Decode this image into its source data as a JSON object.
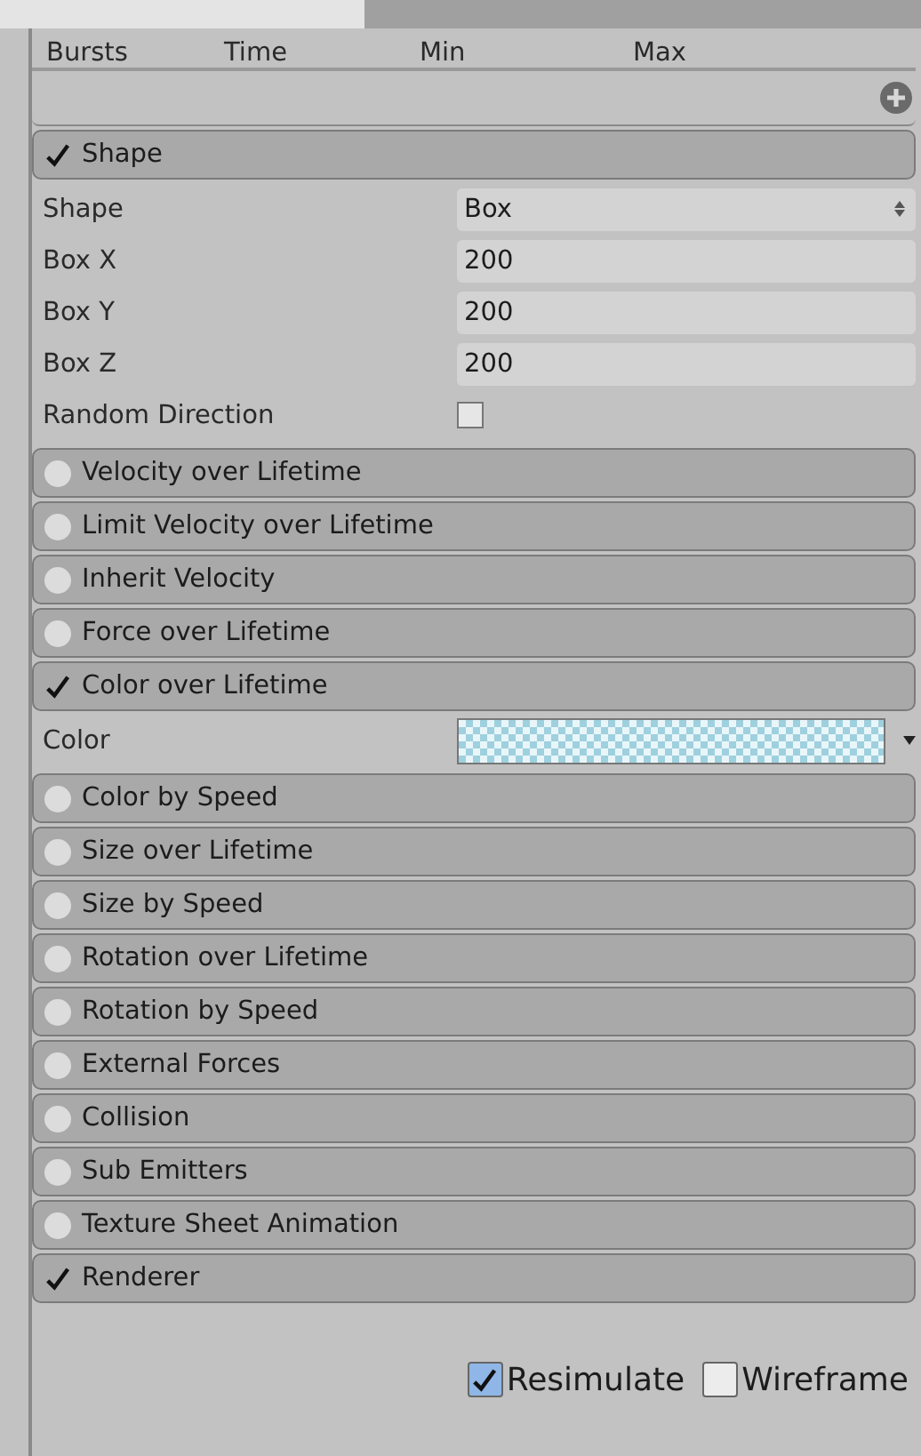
{
  "bursts": {
    "columns": [
      "Bursts",
      "Time",
      "Min",
      "Max"
    ]
  },
  "modules": [
    {
      "title": "Shape",
      "enabled": true,
      "fields": [
        {
          "kind": "dropdown",
          "label": "Shape",
          "value": "Box"
        },
        {
          "kind": "number",
          "label": "Box X",
          "value": "200"
        },
        {
          "kind": "number",
          "label": "Box Y",
          "value": "200"
        },
        {
          "kind": "number",
          "label": "Box Z",
          "value": "200"
        },
        {
          "kind": "checkbox",
          "label": "Random Direction",
          "checked": false
        }
      ]
    },
    {
      "title": "Velocity over Lifetime",
      "enabled": false
    },
    {
      "title": "Limit Velocity over Lifetime",
      "enabled": false
    },
    {
      "title": "Inherit Velocity",
      "enabled": false
    },
    {
      "title": "Force over Lifetime",
      "enabled": false
    },
    {
      "title": "Color over Lifetime",
      "enabled": true,
      "fields": [
        {
          "kind": "gradient",
          "label": "Color"
        }
      ]
    },
    {
      "title": "Color by Speed",
      "enabled": false
    },
    {
      "title": "Size over Lifetime",
      "enabled": false
    },
    {
      "title": "Size by Speed",
      "enabled": false
    },
    {
      "title": "Rotation over Lifetime",
      "enabled": false
    },
    {
      "title": "Rotation by Speed",
      "enabled": false
    },
    {
      "title": "External Forces",
      "enabled": false
    },
    {
      "title": "Collision",
      "enabled": false
    },
    {
      "title": "Sub Emitters",
      "enabled": false
    },
    {
      "title": "Texture Sheet Animation",
      "enabled": false
    },
    {
      "title": "Renderer",
      "enabled": true
    }
  ],
  "footer": [
    {
      "label": "Resimulate",
      "checked": true
    },
    {
      "label": "Wireframe",
      "checked": false
    }
  ]
}
